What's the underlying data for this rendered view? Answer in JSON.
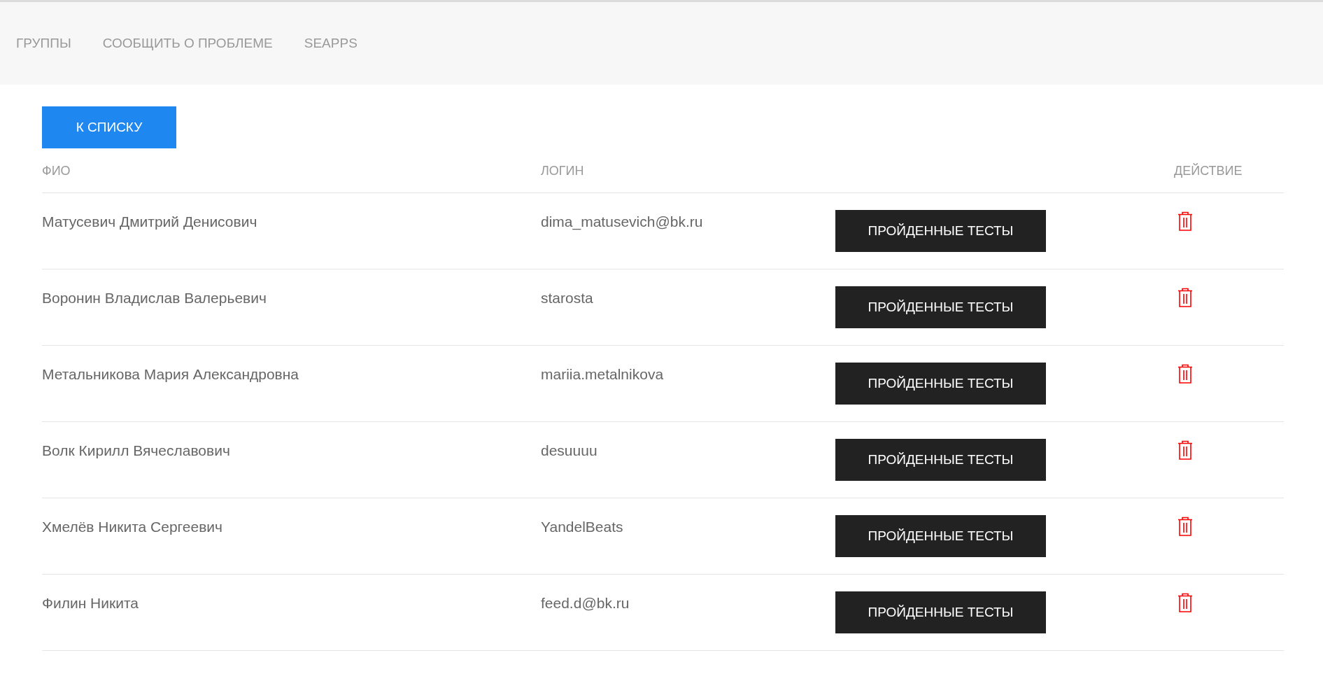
{
  "nav": {
    "items": [
      "ГРУППЫ",
      "СООБЩИТЬ О ПРОБЛЕМЕ",
      "SEAPPS"
    ]
  },
  "back_button": "К СПИСКУ",
  "table": {
    "columns": [
      "ФИО",
      "ЛОГИН",
      "ДЕЙСТВИЕ"
    ],
    "rows": [
      {
        "name": "Матусевич Дмитрий Денисович",
        "login": "dima_matusevich@bk.ru",
        "button": "ПРОЙДЕННЫЕ ТЕСТЫ"
      },
      {
        "name": "Воронин Владислав Валерьевич",
        "login": "starosta",
        "button": "ПРОЙДЕННЫЕ ТЕСТЫ"
      },
      {
        "name": "Метальникова Мария Александровна",
        "login": "mariia.metalnikova",
        "button": "ПРОЙДЕННЫЕ ТЕСТЫ"
      },
      {
        "name": "Волк Кирилл Вячеславович",
        "login": "desuuuu",
        "button": "ПРОЙДЕННЫЕ ТЕСТЫ"
      },
      {
        "name": "Хмелёв Никита Сергеевич",
        "login": "YandelBeats",
        "button": "ПРОЙДЕННЫЕ ТЕСТЫ"
      },
      {
        "name": "Филин Никита",
        "login": "feed.d@bk.ru",
        "button": "ПРОЙДЕННЫЕ ТЕСТЫ"
      }
    ]
  }
}
